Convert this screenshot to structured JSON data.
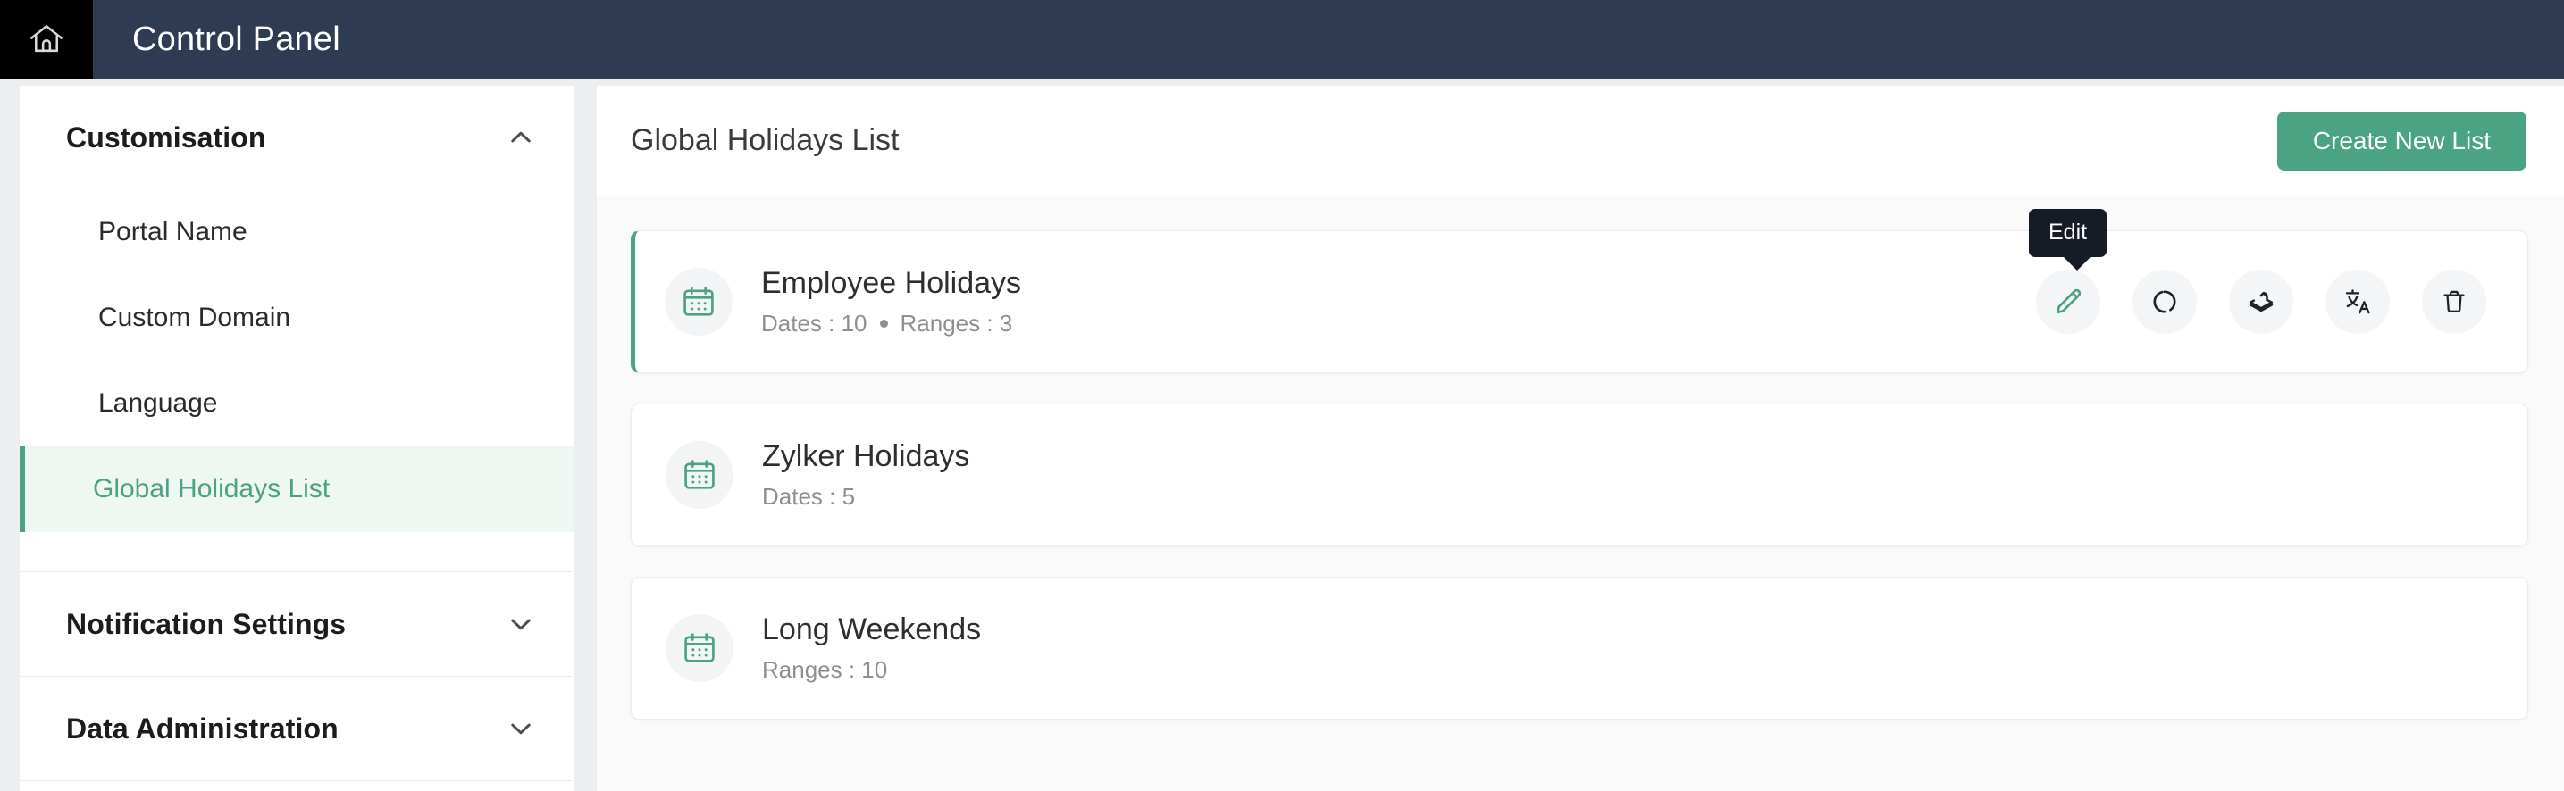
{
  "topbar": {
    "home_icon": "home-icon",
    "title": "Control Panel"
  },
  "sidebar": {
    "sections": [
      {
        "title": "Customisation",
        "chevron": "chevron-up-icon",
        "expanded": true,
        "items": [
          {
            "label": "Portal Name",
            "selected": false
          },
          {
            "label": "Custom Domain",
            "selected": false
          },
          {
            "label": "Language",
            "selected": false
          },
          {
            "label": "Global Holidays List",
            "selected": true
          }
        ]
      },
      {
        "title": "Notification Settings",
        "chevron": "chevron-down-icon",
        "expanded": false,
        "items": []
      },
      {
        "title": "Data Administration",
        "chevron": "chevron-down-icon",
        "expanded": false,
        "items": []
      }
    ]
  },
  "main": {
    "page_title": "Global Holidays List",
    "create_button": "Create New List",
    "tooltip": "Edit",
    "cards": [
      {
        "name": "Employee Holidays",
        "meta_primary": "Dates : 10",
        "meta_secondary": "Ranges : 3",
        "has_dot": true,
        "active": true,
        "icon": "calendar-icon",
        "actions": [
          {
            "name": "edit-button",
            "icon": "pencil-icon",
            "tooltip": "Edit"
          },
          {
            "name": "refresh-button",
            "icon": "circular-arrow-icon"
          },
          {
            "name": "duplicate-button",
            "icon": "layers-arrow-icon"
          },
          {
            "name": "translate-button",
            "icon": "translate-icon"
          },
          {
            "name": "delete-button",
            "icon": "trash-icon"
          }
        ]
      },
      {
        "name": "Zylker Holidays",
        "meta_primary": "Dates : 5",
        "meta_secondary": "",
        "has_dot": false,
        "active": false,
        "icon": "calendar-icon",
        "actions": []
      },
      {
        "name": "Long Weekends",
        "meta_primary": "Ranges : 10",
        "meta_secondary": "",
        "has_dot": false,
        "active": false,
        "icon": "calendar-icon",
        "actions": []
      }
    ]
  },
  "colors": {
    "topbar_bg": "#2f3a53",
    "home_tile_bg": "#000000",
    "accent_green": "#4aa383",
    "selected_bg": "#eff7f3",
    "page_bg": "#edeeef",
    "card_bg": "#ffffff",
    "tooltip_bg": "#151c26"
  }
}
